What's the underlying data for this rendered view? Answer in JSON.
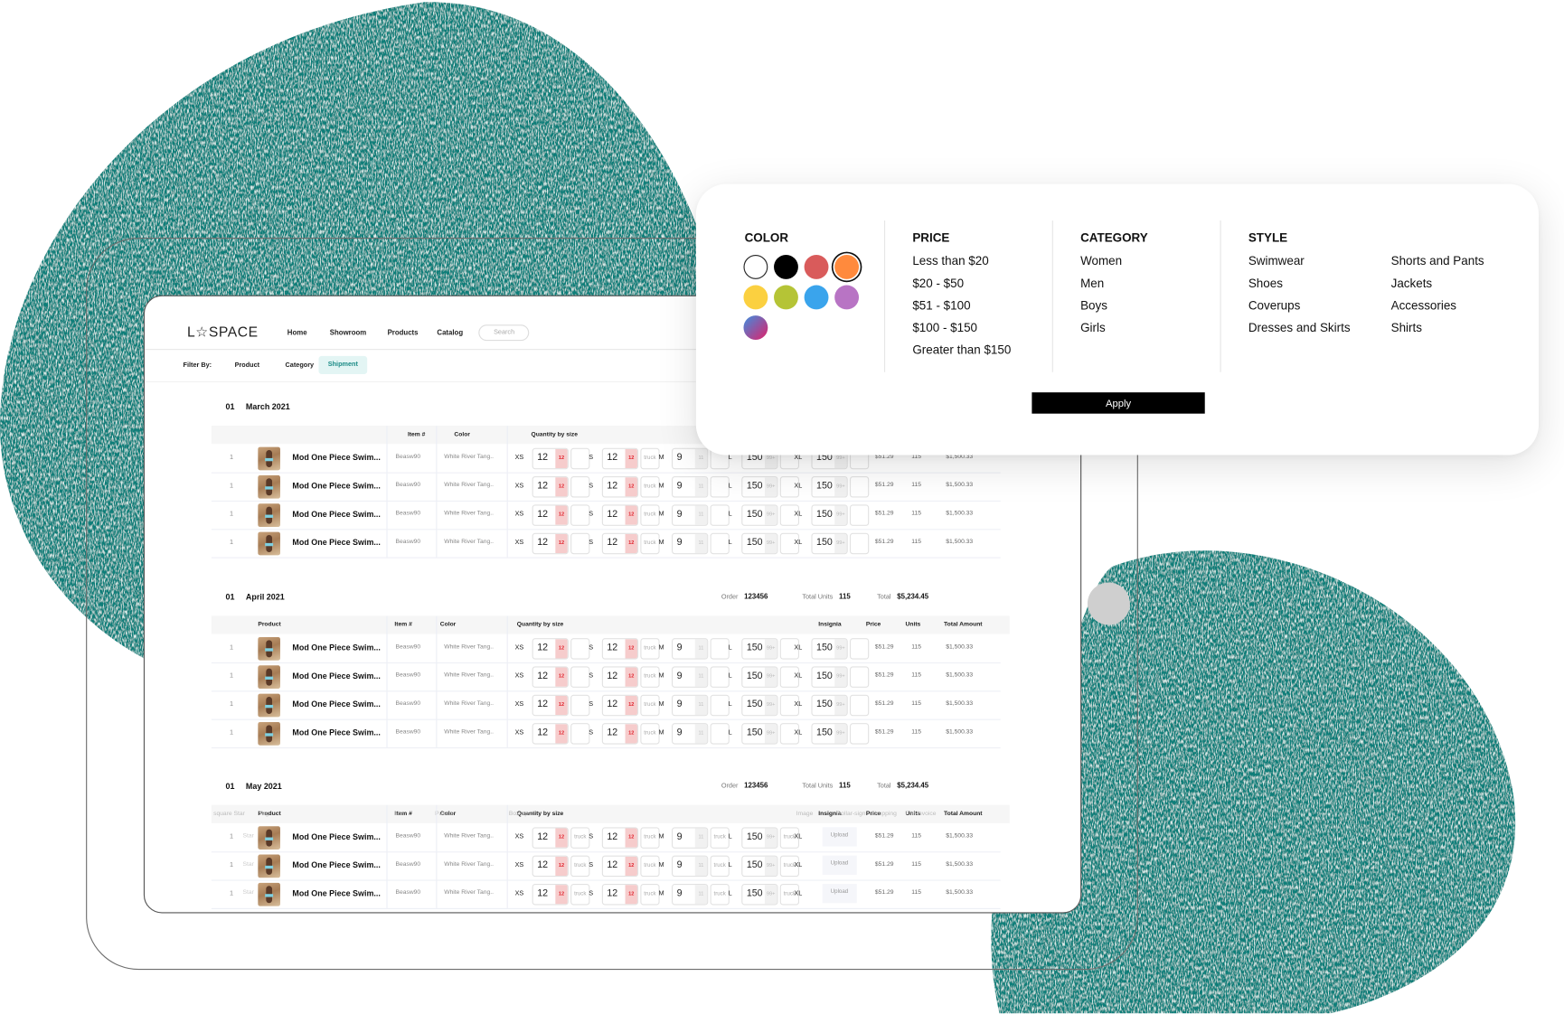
{
  "colors": {
    "teal": "#0b7e79",
    "accent_teal": "#1b8b86",
    "badge_red": "#e0202a",
    "badge_bg": "#f6cccc"
  },
  "app": {
    "logo": "L☆SPACE",
    "nav": [
      "Home",
      "Showroom",
      "Products",
      "Catalog"
    ],
    "search_placeholder": "Search",
    "filter_label": "Filter By:",
    "filters": [
      "Product",
      "Category",
      "Shipment"
    ],
    "active_filter": "Shipment"
  },
  "sections": [
    {
      "index": "01",
      "month": "March 2021",
      "summary": null,
      "headers": {
        "product": "",
        "item": "Item #",
        "color": "Color",
        "qty": "Quantity by size"
      },
      "ghost_headers": [],
      "rows": [
        {
          "num": "1",
          "star": "",
          "product": "Mod One Piece Swim...",
          "item": "Beasw90",
          "color": "White River Tang..",
          "sizes": [
            {
              "label": "XS",
              "qty": "12",
              "badge": "12",
              "badge_type": "red",
              "extra": ""
            },
            {
              "label": "S",
              "qty": "12",
              "badge": "12",
              "badge_type": "red",
              "extra": "truck"
            },
            {
              "label": "M",
              "qty": "9",
              "badge": "11",
              "badge_type": "grey",
              "extra": ""
            },
            {
              "label": "L",
              "qty": "150",
              "badge": "99+",
              "badge_type": "grey",
              "extra": ""
            },
            {
              "label": "XL",
              "qty": "150",
              "badge": "99+",
              "badge_type": "grey",
              "extra": ""
            }
          ],
          "insignia": null,
          "price": "$51.29",
          "units": "115",
          "total": "$1,500.33"
        },
        {
          "num": "1",
          "star": "",
          "product": "Mod One Piece Swim...",
          "item": "Beasw90",
          "color": "White River Tang..",
          "sizes": [
            {
              "label": "XS",
              "qty": "12",
              "badge": "12",
              "badge_type": "red",
              "extra": ""
            },
            {
              "label": "S",
              "qty": "12",
              "badge": "12",
              "badge_type": "red",
              "extra": "truck"
            },
            {
              "label": "M",
              "qty": "9",
              "badge": "11",
              "badge_type": "grey",
              "extra": ""
            },
            {
              "label": "L",
              "qty": "150",
              "badge": "99+",
              "badge_type": "grey",
              "extra": ""
            },
            {
              "label": "XL",
              "qty": "150",
              "badge": "99+",
              "badge_type": "grey",
              "extra": ""
            }
          ],
          "insignia": null,
          "price": "$51.29",
          "units": "115",
          "total": "$1,500.33"
        },
        {
          "num": "1",
          "star": "",
          "product": "Mod One Piece Swim...",
          "item": "Beasw90",
          "color": "White River Tang..",
          "sizes": [
            {
              "label": "XS",
              "qty": "12",
              "badge": "12",
              "badge_type": "red",
              "extra": ""
            },
            {
              "label": "S",
              "qty": "12",
              "badge": "12",
              "badge_type": "red",
              "extra": "truck"
            },
            {
              "label": "M",
              "qty": "9",
              "badge": "11",
              "badge_type": "grey",
              "extra": ""
            },
            {
              "label": "L",
              "qty": "150",
              "badge": "99+",
              "badge_type": "grey",
              "extra": ""
            },
            {
              "label": "XL",
              "qty": "150",
              "badge": "99+",
              "badge_type": "grey",
              "extra": ""
            }
          ],
          "insignia": null,
          "price": "$51.29",
          "units": "115",
          "total": "$1,500.33"
        },
        {
          "num": "1",
          "star": "",
          "product": "Mod One Piece Swim...",
          "item": "Beasw90",
          "color": "White River Tang..",
          "sizes": [
            {
              "label": "XS",
              "qty": "12",
              "badge": "12",
              "badge_type": "red",
              "extra": ""
            },
            {
              "label": "S",
              "qty": "12",
              "badge": "12",
              "badge_type": "red",
              "extra": "truck"
            },
            {
              "label": "M",
              "qty": "9",
              "badge": "11",
              "badge_type": "grey",
              "extra": ""
            },
            {
              "label": "L",
              "qty": "150",
              "badge": "99+",
              "badge_type": "grey",
              "extra": ""
            },
            {
              "label": "XL",
              "qty": "150",
              "badge": "99+",
              "badge_type": "grey",
              "extra": ""
            }
          ],
          "insignia": null,
          "price": "$51.29",
          "units": "115",
          "total": "$1,500.33"
        }
      ]
    },
    {
      "index": "01",
      "month": "April 2021",
      "summary": {
        "order_label": "Order",
        "order": "123456",
        "units_label": "Total Units",
        "units": "115",
        "total_label": "Total",
        "total": "$5,234.45"
      },
      "headers": {
        "product": "Product",
        "item": "Item #",
        "color": "Color",
        "qty": "Quantity by size",
        "insignia": "Insignia",
        "price": "Price",
        "units": "Units",
        "total": "Total Amount"
      },
      "ghost_headers": [],
      "rows": [
        {
          "num": "1",
          "star": "",
          "product": "Mod One Piece Swim...",
          "item": "Beasw90",
          "color": "White River Tang..",
          "sizes": [
            {
              "label": "XS",
              "qty": "12",
              "badge": "12",
              "badge_type": "red",
              "extra": ""
            },
            {
              "label": "S",
              "qty": "12",
              "badge": "12",
              "badge_type": "red",
              "extra": "truck"
            },
            {
              "label": "M",
              "qty": "9",
              "badge": "11",
              "badge_type": "grey",
              "extra": ""
            },
            {
              "label": "L",
              "qty": "150",
              "badge": "99+",
              "badge_type": "grey",
              "extra": ""
            },
            {
              "label": "XL",
              "qty": "150",
              "badge": "99+",
              "badge_type": "grey",
              "extra": ""
            }
          ],
          "insignia": null,
          "price": "$51.29",
          "units": "115",
          "total": "$1,500.33"
        },
        {
          "num": "1",
          "star": "",
          "product": "Mod One Piece Swim...",
          "item": "Beasw90",
          "color": "White River Tang..",
          "sizes": [
            {
              "label": "XS",
              "qty": "12",
              "badge": "12",
              "badge_type": "red",
              "extra": ""
            },
            {
              "label": "S",
              "qty": "12",
              "badge": "12",
              "badge_type": "red",
              "extra": "truck"
            },
            {
              "label": "M",
              "qty": "9",
              "badge": "11",
              "badge_type": "grey",
              "extra": ""
            },
            {
              "label": "L",
              "qty": "150",
              "badge": "99+",
              "badge_type": "grey",
              "extra": ""
            },
            {
              "label": "XL",
              "qty": "150",
              "badge": "99+",
              "badge_type": "grey",
              "extra": ""
            }
          ],
          "insignia": null,
          "price": "$51.29",
          "units": "115",
          "total": "$1,500.33"
        },
        {
          "num": "1",
          "star": "",
          "product": "Mod One Piece Swim...",
          "item": "Beasw90",
          "color": "White River Tang..",
          "sizes": [
            {
              "label": "XS",
              "qty": "12",
              "badge": "12",
              "badge_type": "red",
              "extra": ""
            },
            {
              "label": "S",
              "qty": "12",
              "badge": "12",
              "badge_type": "red",
              "extra": "truck"
            },
            {
              "label": "M",
              "qty": "9",
              "badge": "11",
              "badge_type": "grey",
              "extra": ""
            },
            {
              "label": "L",
              "qty": "150",
              "badge": "99+",
              "badge_type": "grey",
              "extra": ""
            },
            {
              "label": "XL",
              "qty": "150",
              "badge": "99+",
              "badge_type": "grey",
              "extra": ""
            }
          ],
          "insignia": null,
          "price": "$51.29",
          "units": "115",
          "total": "$1,500.33"
        },
        {
          "num": "1",
          "star": "",
          "product": "Mod One Piece Swim...",
          "item": "Beasw90",
          "color": "White River Tang..",
          "sizes": [
            {
              "label": "XS",
              "qty": "12",
              "badge": "12",
              "badge_type": "red",
              "extra": ""
            },
            {
              "label": "S",
              "qty": "12",
              "badge": "12",
              "badge_type": "red",
              "extra": "truck"
            },
            {
              "label": "M",
              "qty": "9",
              "badge": "11",
              "badge_type": "grey",
              "extra": ""
            },
            {
              "label": "L",
              "qty": "150",
              "badge": "99+",
              "badge_type": "grey",
              "extra": ""
            },
            {
              "label": "XL",
              "qty": "150",
              "badge": "99+",
              "badge_type": "grey",
              "extra": ""
            }
          ],
          "insignia": null,
          "price": "$51.29",
          "units": "115",
          "total": "$1,500.33"
        }
      ]
    },
    {
      "index": "01",
      "month": "May 2021",
      "summary": {
        "order_label": "Order",
        "order": "123456",
        "units_label": "Total Units",
        "units": "115",
        "total_label": "Total",
        "total": "$5,234.45"
      },
      "headers": {
        "product": "Product",
        "item": "Item #",
        "color": "Color",
        "qty": "Quantity by size",
        "insignia": "Insignia",
        "price": "Price",
        "units": "Units",
        "total": "Total Amount"
      },
      "ghost_headers": [
        "square",
        "Star",
        "Tag",
        "List",
        "Palette",
        "Box-open",
        "Image",
        "Dollar-sign",
        "Shopping",
        "File-invoice"
      ],
      "rows": [
        {
          "num": "1",
          "star": "Star",
          "product": "Mod One Piece Swim...",
          "item": "Beasw90",
          "color": "White River Tang..",
          "sizes": [
            {
              "label": "XS",
              "qty": "12",
              "badge": "12",
              "badge_type": "red",
              "extra": "truck"
            },
            {
              "label": "S",
              "qty": "12",
              "badge": "12",
              "badge_type": "red",
              "extra": "truck"
            },
            {
              "label": "M",
              "qty": "9",
              "badge": "11",
              "badge_type": "grey",
              "extra": "truck"
            },
            {
              "label": "L",
              "qty": "150",
              "badge": "99+",
              "badge_type": "grey",
              "extra": "truck"
            },
            {
              "label": "XL",
              "qty": "",
              "badge": "",
              "badge_type": "none",
              "extra": ""
            }
          ],
          "insignia": "Upload",
          "price": "$51.29",
          "units": "115",
          "total": "$1,500.33"
        },
        {
          "num": "1",
          "star": "Star",
          "product": "Mod One Piece Swim...",
          "item": "Beasw90",
          "color": "White River Tang..",
          "sizes": [
            {
              "label": "XS",
              "qty": "12",
              "badge": "12",
              "badge_type": "red",
              "extra": "truck"
            },
            {
              "label": "S",
              "qty": "12",
              "badge": "12",
              "badge_type": "red",
              "extra": "truck"
            },
            {
              "label": "M",
              "qty": "9",
              "badge": "11",
              "badge_type": "grey",
              "extra": "truck"
            },
            {
              "label": "L",
              "qty": "150",
              "badge": "99+",
              "badge_type": "grey",
              "extra": "truck"
            },
            {
              "label": "XL",
              "qty": "",
              "badge": "",
              "badge_type": "none",
              "extra": ""
            }
          ],
          "insignia": "Upload",
          "price": "$51.29",
          "units": "115",
          "total": "$1,500.33"
        },
        {
          "num": "1",
          "star": "Star",
          "product": "Mod One Piece Swim...",
          "item": "Beasw90",
          "color": "White River Tang..",
          "sizes": [
            {
              "label": "XS",
              "qty": "12",
              "badge": "12",
              "badge_type": "red",
              "extra": "truck"
            },
            {
              "label": "S",
              "qty": "12",
              "badge": "12",
              "badge_type": "red",
              "extra": "truck"
            },
            {
              "label": "M",
              "qty": "9",
              "badge": "11",
              "badge_type": "grey",
              "extra": "truck"
            },
            {
              "label": "L",
              "qty": "150",
              "badge": "99+",
              "badge_type": "grey",
              "extra": "truck"
            },
            {
              "label": "XL",
              "qty": "",
              "badge": "",
              "badge_type": "none",
              "extra": ""
            }
          ],
          "insignia": "Upload",
          "price": "$51.29",
          "units": "115",
          "total": "$1,500.33"
        }
      ]
    }
  ],
  "filter_panel": {
    "color": {
      "title": "COLOR",
      "swatches": [
        "#ffffff",
        "#000000",
        "#d95b5b",
        "#ff8a3d",
        "#fbd040",
        "#b5c436",
        "#3aa4ec",
        "#b874c4",
        "gradient-blue-pink"
      ],
      "selected": "#ff8a3d"
    },
    "price": {
      "title": "PRICE",
      "items": [
        "Less than $20",
        "$20 - $50",
        "$51 - $100",
        "$100 - $150",
        "Greater than $150"
      ]
    },
    "category": {
      "title": "CATEGORY",
      "items": [
        "Women",
        "Men",
        "Boys",
        "Girls"
      ]
    },
    "style": {
      "title": "STYLE",
      "items": [
        "Swimwear",
        "Shoes",
        "Coverups",
        "Dresses and Skirts",
        "Shorts and Pants",
        "Jackets",
        "Accessories",
        "Shirts"
      ]
    },
    "apply_label": "Apply"
  }
}
